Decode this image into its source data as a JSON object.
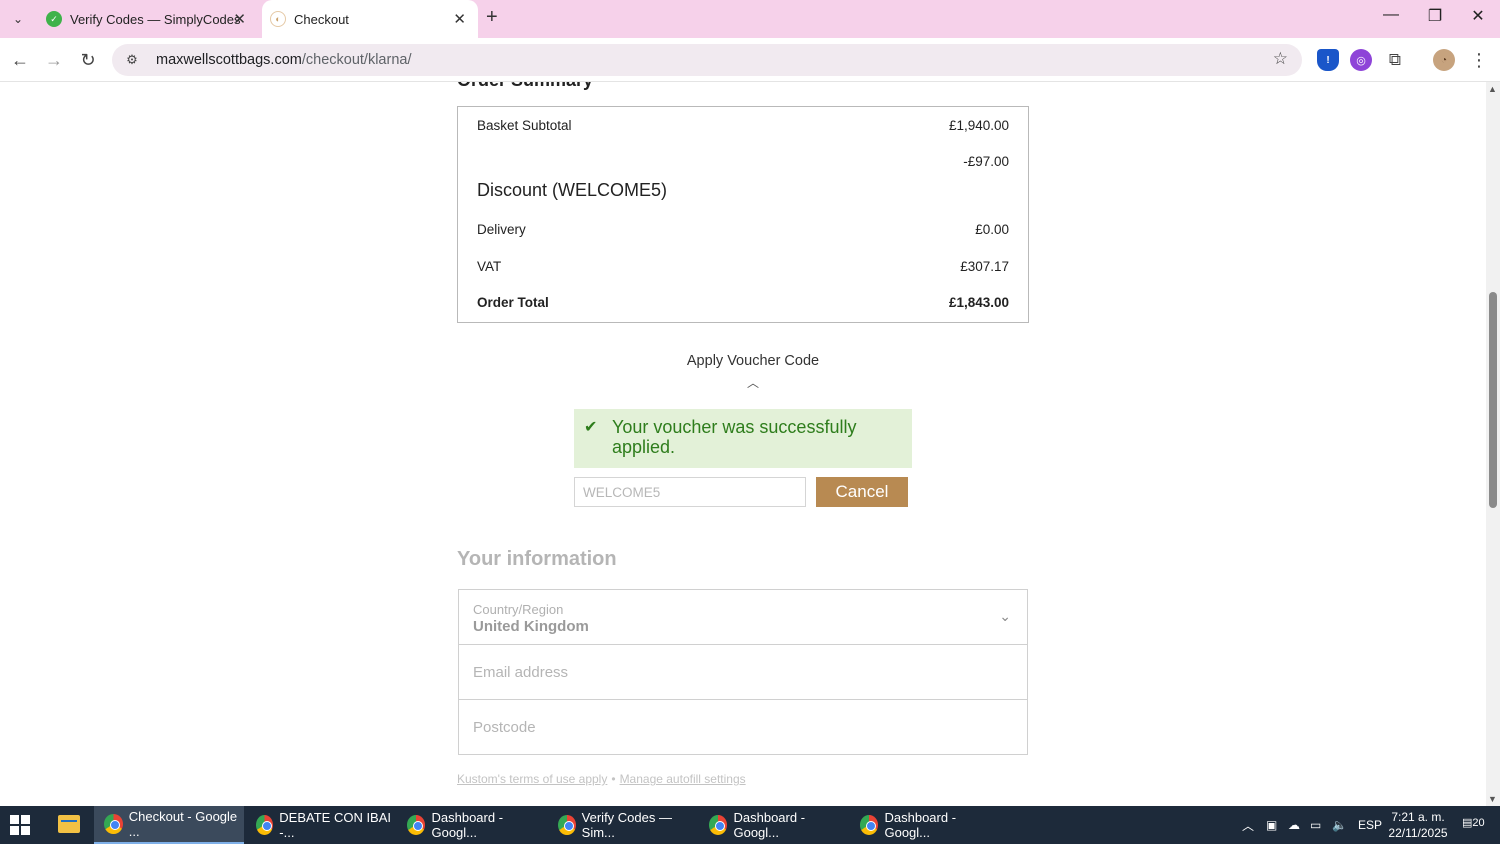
{
  "browser": {
    "tabs": [
      {
        "title": "Verify Codes — SimplyCodes",
        "active": false
      },
      {
        "title": "Checkout",
        "active": true
      }
    ],
    "new_tab_symbol": "+",
    "url_host": "maxwellscottbags.com",
    "url_path": "/checkout/klarna/"
  },
  "order_summary": {
    "title": "Order Summary",
    "rows": [
      {
        "label": "Basket Subtotal",
        "value": "£1,940.00"
      },
      {
        "label": "",
        "value": "-£97.00"
      },
      {
        "label": "Delivery",
        "value": "£0.00"
      },
      {
        "label": "VAT",
        "value": "£307.17"
      },
      {
        "label": "Order Total",
        "value": "£1,843.00"
      }
    ],
    "discount_label": "Discount (WELCOME5)"
  },
  "voucher": {
    "toggle_label": "Apply Voucher Code",
    "success_message": "Your voucher was successfully applied.",
    "code_value": "WELCOME5",
    "cancel_label": "Cancel"
  },
  "your_information": {
    "title": "Your information",
    "country_label": "Country/Region",
    "country_value": "United Kingdom",
    "email_placeholder": "Email address",
    "postcode_placeholder": "Postcode"
  },
  "legal": {
    "terms_link": "Kustom's terms of use apply",
    "separator": "•",
    "autofill_link": "Manage autofill settings"
  },
  "taskbar": {
    "items": [
      {
        "label": "Checkout - Google ...",
        "active": true
      },
      {
        "label": "DEBATE CON IBAI -...",
        "active": false
      },
      {
        "label": "Dashboard - Googl...",
        "active": false
      },
      {
        "label": "Verify Codes — Sim...",
        "active": false
      },
      {
        "label": "Dashboard - Googl...",
        "active": false
      },
      {
        "label": "Dashboard - Googl...",
        "active": false
      }
    ],
    "language": "ESP",
    "time": "7:21 a. m.",
    "date": "22/11/2025",
    "notification_count": "20"
  },
  "colors": {
    "tab_strip": "#f6d1ea",
    "success_bg": "#e3f1d8",
    "success_text": "#2e7d1c",
    "cancel_button": "#b88a52",
    "taskbar": "#1d2a3a"
  }
}
